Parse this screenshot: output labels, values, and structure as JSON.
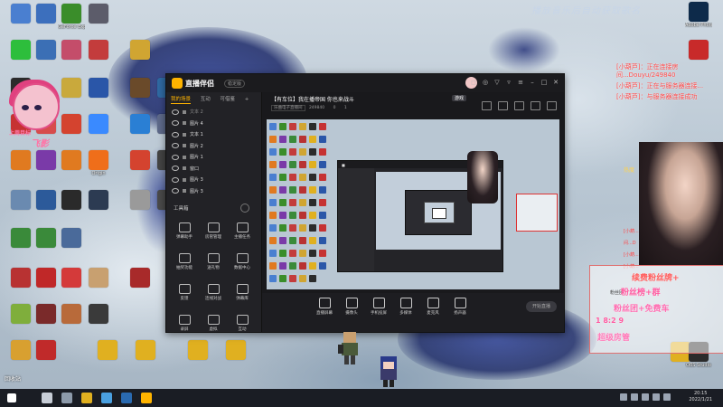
{
  "wallpaper": {
    "top_right_text": "播放音乐后自动获取歌名"
  },
  "streamer": {
    "badge": "上周目标",
    "nickname": "飞影"
  },
  "desktop_icons": [
    {
      "label": "",
      "color": "#4a7fd0"
    },
    {
      "label": "",
      "color": "#3c6fbd"
    },
    {
      "label": "GeForce Experience",
      "color": "#3a8d2a"
    },
    {
      "label": "",
      "color": "#5c5c6a"
    },
    {
      "label": "",
      "color": "#2dbe3c"
    },
    {
      "label": "",
      "color": "#3b6fb5"
    },
    {
      "label": "",
      "color": "#c44d6a"
    },
    {
      "label": "",
      "color": "#c33c3c"
    },
    {
      "label": "",
      "color": "#d0a532"
    },
    {
      "label": "",
      "color": "#2b2b2b"
    },
    {
      "label": "",
      "color": "#c9a93c"
    },
    {
      "label": "",
      "color": "#2a56a8"
    },
    {
      "label": "",
      "color": "#6a4a2a"
    },
    {
      "label": "",
      "color": "#2f6aa3"
    },
    {
      "label": "",
      "color": "#c63232"
    },
    {
      "label": "",
      "color": "#d74c4c"
    },
    {
      "label": "",
      "color": "#d4432f"
    },
    {
      "label": "",
      "color": "#3a8aff"
    },
    {
      "label": "",
      "color": "#2a7fd4"
    },
    {
      "label": "",
      "color": "#5e6a8a"
    },
    {
      "label": "",
      "color": "#e07a20"
    },
    {
      "label": "",
      "color": "#7a3aa8"
    },
    {
      "label": "",
      "color": "#e07a20"
    },
    {
      "label": "Origin",
      "color": "#ef6e1a"
    },
    {
      "label": "",
      "color": "#d4432f"
    },
    {
      "label": "",
      "color": "#444"
    },
    {
      "label": "",
      "color": "#6a8ab0"
    },
    {
      "label": "",
      "color": "#2c5a9a"
    },
    {
      "label": "",
      "color": "#2a2a2a"
    },
    {
      "label": "",
      "color": "#2c3b52"
    },
    {
      "label": "",
      "color": "#9a9a9a"
    },
    {
      "label": "",
      "color": "#4a4a4a"
    },
    {
      "label": "",
      "color": "#3a8a3a"
    },
    {
      "label": "",
      "color": "#3a8a3a"
    },
    {
      "label": "",
      "color": "#4a6a9a"
    },
    {
      "label": "",
      "color": "#b83232"
    },
    {
      "label": "",
      "color": "#c02828"
    },
    {
      "label": "",
      "color": "#d43a3a"
    },
    {
      "label": "",
      "color": "#c8a070"
    },
    {
      "label": "",
      "color": "#a82a2a"
    },
    {
      "label": "",
      "color": "#7fae3c"
    },
    {
      "label": "",
      "color": "#7a2a2a"
    },
    {
      "label": "",
      "color": "#b86a3a"
    },
    {
      "label": "",
      "color": "#3a3a3a"
    },
    {
      "label": "",
      "color": "#d8a030"
    },
    {
      "label": "",
      "color": "#c02a2a"
    },
    {
      "label": "",
      "color": "#e0b020"
    },
    {
      "label": "",
      "color": "#e0b020"
    },
    {
      "label": "",
      "color": "#e0b020"
    },
    {
      "label": "",
      "color": "#e0b020"
    }
  ],
  "right_icons": [
    {
      "label": "Adobe Photosh...",
      "color": "#0d2a4a"
    },
    {
      "label": "",
      "color": "#c82a2a"
    },
    {
      "label": "",
      "color": "#e0b020"
    },
    {
      "label": "OBS Studio",
      "color": "#2b2b2b"
    }
  ],
  "window": {
    "app_name": "直播伴侣",
    "badge": "稳定版",
    "tabs": [
      "我的场景",
      "互动",
      "可借鉴"
    ],
    "active_tab": "我的场景",
    "layers": [
      {
        "name": "文本 2",
        "head": true
      },
      {
        "name": "图片 4"
      },
      {
        "name": "文本 1"
      },
      {
        "name": "图片 2"
      },
      {
        "name": "图片 1"
      },
      {
        "name": "窗口"
      },
      {
        "name": "图片 3"
      },
      {
        "name": "图片 3"
      }
    ],
    "toolbox_title": "工具箱",
    "tools": [
      {
        "label": "弹幕助手"
      },
      {
        "label": "房管管理"
      },
      {
        "label": "主播任务"
      },
      {
        "label": "抽奖功能"
      },
      {
        "label": "送礼物"
      },
      {
        "label": "数据中心"
      },
      {
        "label": "反馈",
        "icon": "feedback"
      },
      {
        "label": "连线对战"
      },
      {
        "label": "弹幕库"
      },
      {
        "label": "录屏"
      },
      {
        "label": "虚拟"
      },
      {
        "label": "互动"
      }
    ],
    "stream_title": "【有车位】我在播帝国 你也来战斗",
    "stream_tag": "游戏",
    "stream_meta": {
      "category": "乐曲电子直播间",
      "viewers": "249840",
      "likes": "0",
      "shares": "1"
    },
    "bottom_actions": [
      {
        "label": "直播屏幕"
      },
      {
        "label": "摄像头"
      },
      {
        "label": "手机投屏"
      },
      {
        "label": "多媒体"
      },
      {
        "label": "麦克风"
      },
      {
        "label": "扬声器"
      }
    ],
    "start_label": "开始直播"
  },
  "chat": [
    "[小葫芦]：正在连接房间...Douyu/249840",
    "[小葫芦]：正在与服务器连接...",
    "[小葫芦]：与服务器连接成功"
  ],
  "side_snippets": [
    "[小葫...",
    "间...D",
    "[小葫...",
    "[小葫..."
  ],
  "heat_label": "热度",
  "gift_panel": {
    "line1": "续费粉丝牌+",
    "line2": "粉丝榜+群",
    "line3": "粉丝团+免费车",
    "line4": "超级房管",
    "small1": "粉丝团",
    "small2": "1 8:2 9"
  },
  "desktop_note": "回收站",
  "taskbar": {
    "time": "20:15",
    "date": "2022/1/21"
  }
}
